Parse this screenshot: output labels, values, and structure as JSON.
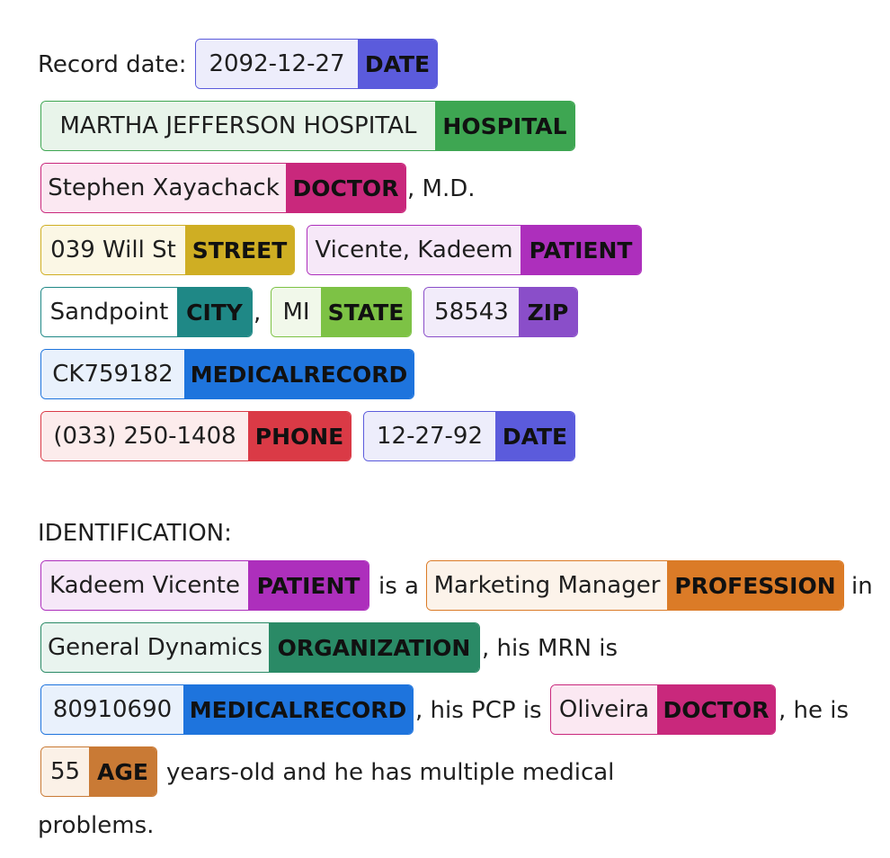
{
  "header": {
    "record_date_label": "Record date:",
    "record_date": {
      "text": "2092-12-27",
      "label": "DATE"
    }
  },
  "hospital": {
    "text": "MARTHA JEFFERSON HOSPITAL",
    "label": "HOSPITAL"
  },
  "doctor_line": {
    "doctor": {
      "text": "Stephen Xayachack",
      "label": "DOCTOR"
    },
    "suffix": ", M.D."
  },
  "address_line": {
    "street": {
      "text": "039 Will St",
      "label": "STREET"
    },
    "patient": {
      "text": "Vicente, Kadeem",
      "label": "PATIENT"
    }
  },
  "location_line": {
    "city": {
      "text": "Sandpoint",
      "label": "CITY"
    },
    "comma": ",",
    "state": {
      "text": "MI",
      "label": "STATE"
    },
    "zip": {
      "text": "58543",
      "label": "ZIP"
    }
  },
  "mrn_line": {
    "medical_record": {
      "text": "CK759182",
      "label": "MEDICALRECORD"
    }
  },
  "phone_line": {
    "phone": {
      "text": "(033) 250-1408",
      "label": "PHONE"
    },
    "date": {
      "text": "12-27-92",
      "label": "DATE"
    }
  },
  "identification": {
    "heading": "IDENTIFICATION:",
    "patient": {
      "text": "Kadeem Vicente",
      "label": "PATIENT"
    },
    "is_a": "is a",
    "profession": {
      "text": "Marketing Manager",
      "label": "PROFESSION"
    },
    "in": "in",
    "organization": {
      "text": "General Dynamics",
      "label": "ORGANIZATION"
    },
    "mrn_phrase": ", his MRN is",
    "medical_record": {
      "text": "80910690",
      "label": "MEDICALRECORD"
    },
    "pcp_phrase": ", his PCP is",
    "pcp": {
      "text": "Oliveira",
      "label": "DOCTOR"
    },
    "he_is": ", he is",
    "age": {
      "text": "55",
      "label": "AGE"
    },
    "years_phrase": "years-old and he has multiple medical",
    "problems": "problems."
  },
  "colors": {
    "DATE": "#5b5bdc",
    "HOSPITAL": "#3ea652",
    "DOCTOR": "#c9287c",
    "STREET": "#cfae23",
    "PATIENT": "#ad2fbc",
    "CITY": "#1f8886",
    "STATE": "#7dc245",
    "ZIP": "#8a4ec9",
    "MEDICALRECORD": "#1e74dd",
    "PHONE": "#da3a46",
    "PROFESSION": "#db7b27",
    "ORGANIZATION": "#2a8a66",
    "AGE": "#c97a35"
  }
}
